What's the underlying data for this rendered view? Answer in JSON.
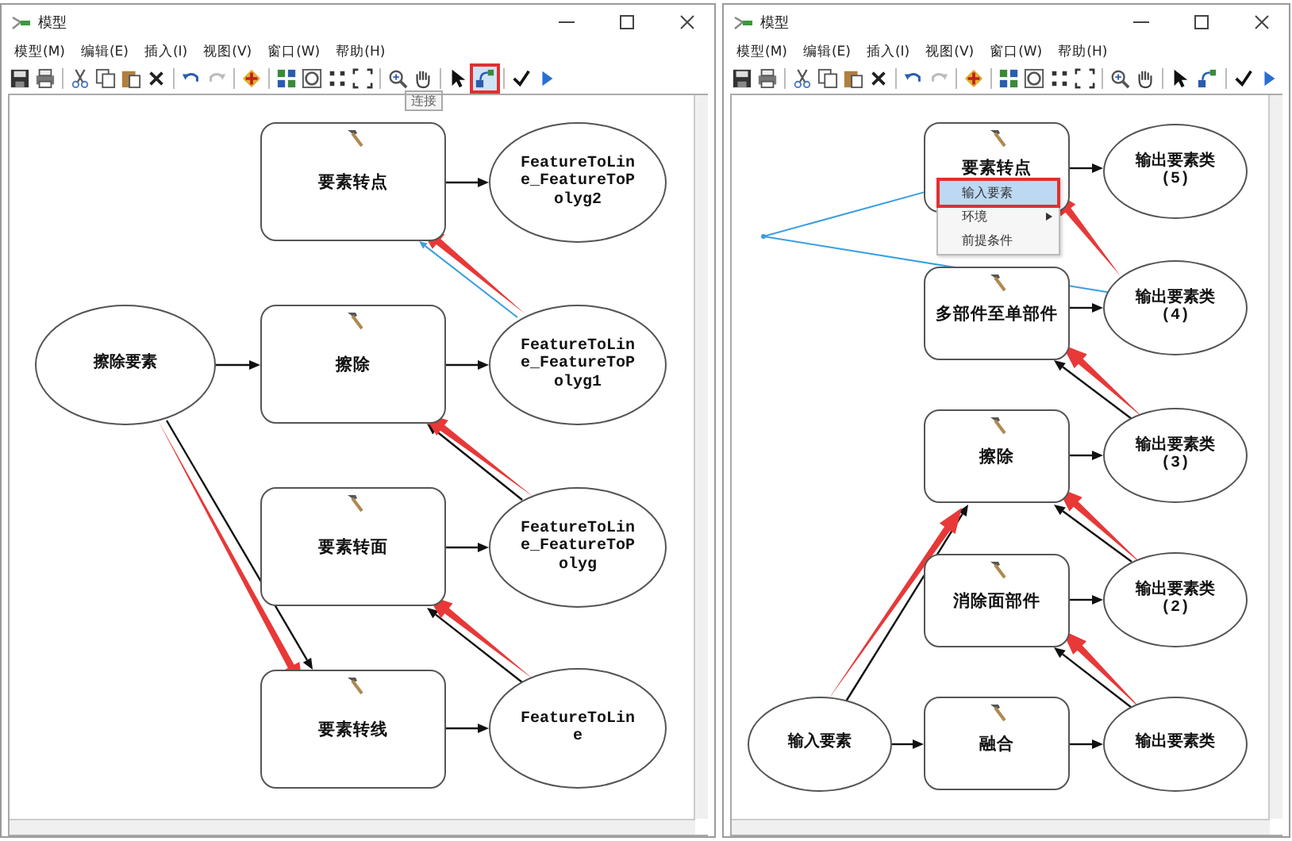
{
  "windows": [
    {
      "title": "模型",
      "menu": [
        "模型(M)",
        "编辑(E)",
        "插入(I)",
        "视图(V)",
        "窗口(W)",
        "帮助(H)"
      ],
      "connect_tool": {
        "selected": true
      },
      "tooltip": "连接",
      "nodes": [
        {
          "kind": "tool",
          "label": "要素转点"
        },
        {
          "kind": "data",
          "label": "FeatureToLine_FeatureToPolyg2"
        },
        {
          "kind": "data",
          "label": "擦除要素"
        },
        {
          "kind": "tool",
          "label": "擦除"
        },
        {
          "kind": "data",
          "label": "FeatureToLine_FeatureToPolyg1"
        },
        {
          "kind": "tool",
          "label": "要素转面"
        },
        {
          "kind": "data",
          "label": "FeatureToLine_FeatureToPolyg"
        },
        {
          "kind": "tool",
          "label": "要素转线"
        },
        {
          "kind": "data",
          "label": "FeatureToLine"
        }
      ]
    },
    {
      "title": "模型",
      "menu": [
        "模型(M)",
        "编辑(E)",
        "插入(I)",
        "视图(V)",
        "窗口(W)",
        "帮助(H)"
      ],
      "connect_tool": {
        "selected": false
      },
      "nodes": [
        {
          "kind": "tool",
          "label": "要素转点"
        },
        {
          "kind": "data",
          "label": "输出要素类 (5)"
        },
        {
          "kind": "tool",
          "label": "多部件至单部件"
        },
        {
          "kind": "data",
          "label": "输出要素类 (4)"
        },
        {
          "kind": "tool",
          "label": "擦除"
        },
        {
          "kind": "data",
          "label": "输出要素类 (3)"
        },
        {
          "kind": "tool",
          "label": "消除面部件"
        },
        {
          "kind": "data",
          "label": "输出要素类 (2)"
        },
        {
          "kind": "data",
          "label": "输入要素"
        },
        {
          "kind": "tool",
          "label": "融合"
        },
        {
          "kind": "data",
          "label": "输出要素类"
        }
      ],
      "context_menu": [
        {
          "label": "输入要素",
          "selected": true,
          "submenu": false
        },
        {
          "label": "环境",
          "selected": false,
          "submenu": true
        },
        {
          "label": "前提条件",
          "selected": false,
          "submenu": false
        }
      ]
    }
  ]
}
